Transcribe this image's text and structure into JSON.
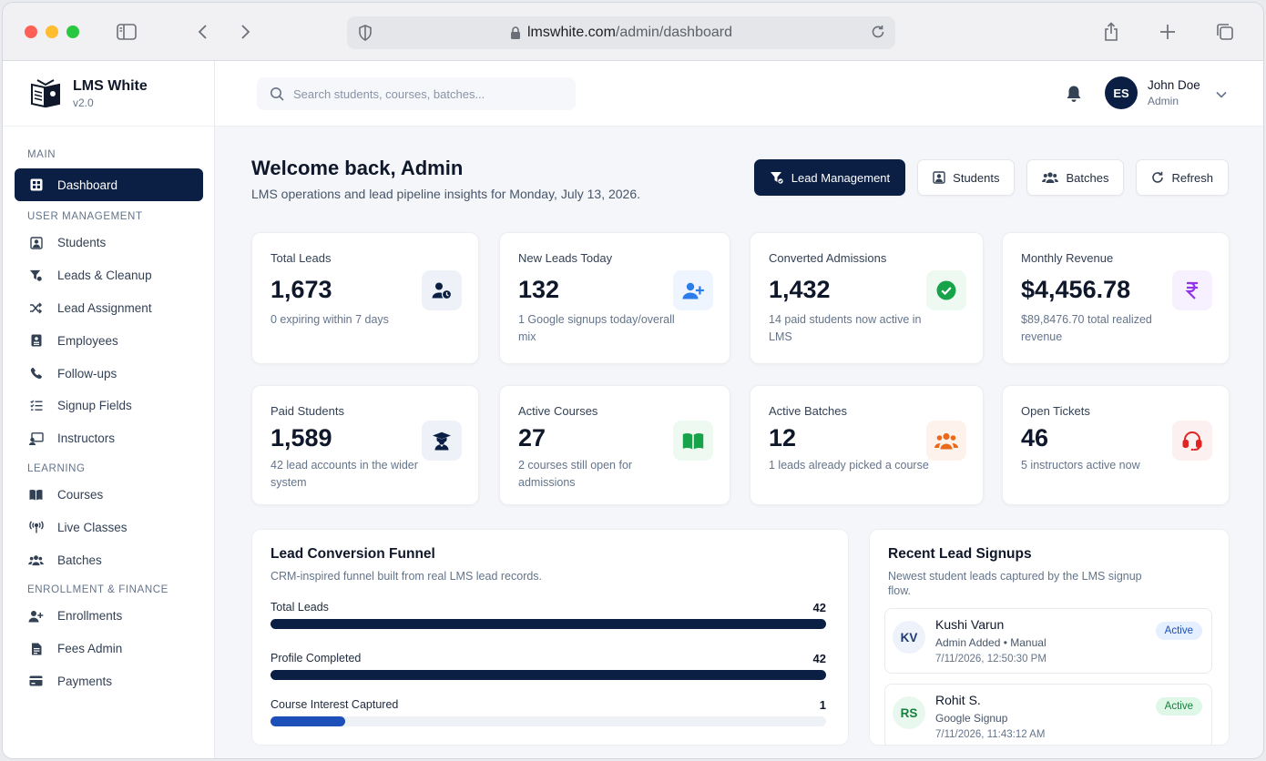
{
  "browser": {
    "url_host": "lmswhite.com",
    "url_path": "/admin/dashboard"
  },
  "brand": {
    "name": "LMS White",
    "version": "v2.0"
  },
  "sidebar": {
    "sections": [
      {
        "title": "MAIN",
        "items": [
          {
            "label": "Dashboard",
            "icon": "dashboard-icon",
            "active": true
          }
        ]
      },
      {
        "title": "USER MANAGEMENT",
        "items": [
          {
            "label": "Students",
            "icon": "student-icon"
          },
          {
            "label": "Leads & Cleanup",
            "icon": "filter-icon"
          },
          {
            "label": "Lead Assignment",
            "icon": "shuffle-icon"
          },
          {
            "label": "Employees",
            "icon": "id-badge-icon"
          },
          {
            "label": "Follow-ups",
            "icon": "phone-icon"
          },
          {
            "label": "Signup Fields",
            "icon": "list-icon"
          },
          {
            "label": "Instructors",
            "icon": "chalkboard-icon"
          }
        ]
      },
      {
        "title": "LEARNING",
        "items": [
          {
            "label": "Courses",
            "icon": "book-icon"
          },
          {
            "label": "Live Classes",
            "icon": "broadcast-icon"
          },
          {
            "label": "Batches",
            "icon": "users-icon"
          }
        ]
      },
      {
        "title": "ENROLLMENT & FINANCE",
        "items": [
          {
            "label": "Enrollments",
            "icon": "user-plus-icon"
          },
          {
            "label": "Fees Admin",
            "icon": "invoice-icon"
          },
          {
            "label": "Payments",
            "icon": "card-icon"
          }
        ]
      }
    ]
  },
  "topbar": {
    "search_placeholder": "Search students, courses, batches...",
    "user": {
      "initials": "ES",
      "name": "John Doe",
      "role": "Admin"
    }
  },
  "welcome": {
    "title": "Welcome back, Admin",
    "subtitle": "LMS operations and lead pipeline insights for Monday, July 13, 2026."
  },
  "actions": {
    "lead_management": "Lead Management",
    "students": "Students",
    "batches": "Batches",
    "refresh": "Refresh"
  },
  "stats": [
    {
      "title": "Total Leads",
      "value": "1,673",
      "sub": "0 expiring within 7 days",
      "icon": "user-clock-icon",
      "color": "#0b1f45",
      "bg": "#eef2f8"
    },
    {
      "title": "New Leads Today",
      "value": "132",
      "sub": "1 Google signups today/overall mix",
      "icon": "user-plus-icon",
      "color": "#2b7de9",
      "bg": "#eef5fe"
    },
    {
      "title": "Converted Admissions",
      "value": "1,432",
      "sub": "14 paid students now active in LMS",
      "icon": "check-circle-icon",
      "color": "#16a34a",
      "bg": "#eefaf1"
    },
    {
      "title": "Monthly Revenue",
      "value": "$4,456.78",
      "sub": "$89,8476.70 total realized revenue",
      "icon": "rupee-icon",
      "color": "#9333ea",
      "bg": "#f7f0fe"
    },
    {
      "title": "Paid Students",
      "value": "1,589",
      "sub": "42 lead accounts in the wider system",
      "icon": "graduate-icon",
      "color": "#0b1f45",
      "bg": "#eef2f8"
    },
    {
      "title": "Active Courses",
      "value": "27",
      "sub": "2 courses still open for admissions",
      "icon": "open-book-icon",
      "color": "#16a34a",
      "bg": "#eefaf1"
    },
    {
      "title": "Active Batches",
      "value": "12",
      "sub": "1 leads already picked a course",
      "icon": "group-icon",
      "color": "#ea6a1d",
      "bg": "#fef3ec"
    },
    {
      "title": "Open Tickets",
      "value": "46",
      "sub": "5 instructors active now",
      "icon": "headset-icon",
      "color": "#e02424",
      "bg": "#fdf0f0"
    }
  ],
  "funnel": {
    "title": "Lead Conversion Funnel",
    "subtitle": "CRM-inspired funnel built from real LMS lead records.",
    "rows": [
      {
        "label": "Total Leads",
        "count": "42",
        "fraction": 1.0,
        "color": "#0b1f45"
      },
      {
        "label": "Profile Completed",
        "count": "42",
        "fraction": 1.0,
        "color": "#0b1f45"
      },
      {
        "label": "Course Interest Captured",
        "count": "1",
        "fraction": 0.135,
        "color": "#1d4fb8"
      }
    ]
  },
  "recent": {
    "title": "Recent Lead Signups",
    "subtitle_line1": "Newest student leads captured by the LMS signup",
    "subtitle_line2": "flow.",
    "leads": [
      {
        "initials": "KV",
        "name": "Kushi Varun",
        "meta": "Admin Added • Manual",
        "time": "7/11/2026, 12:50:30 PM",
        "status": "Active",
        "av_bg": "#eef2fb",
        "av_color": "#1e3a6e",
        "badge_bg": "#e4efff",
        "badge_color": "#1d4fb8"
      },
      {
        "initials": "RS",
        "name": "Rohit S.",
        "meta": "Google Signup",
        "time": "7/11/2026, 11:43:12 AM",
        "status": "Active",
        "av_bg": "#e9f8ee",
        "av_color": "#15803d",
        "badge_bg": "#dff7e7",
        "badge_color": "#15803d"
      }
    ]
  }
}
